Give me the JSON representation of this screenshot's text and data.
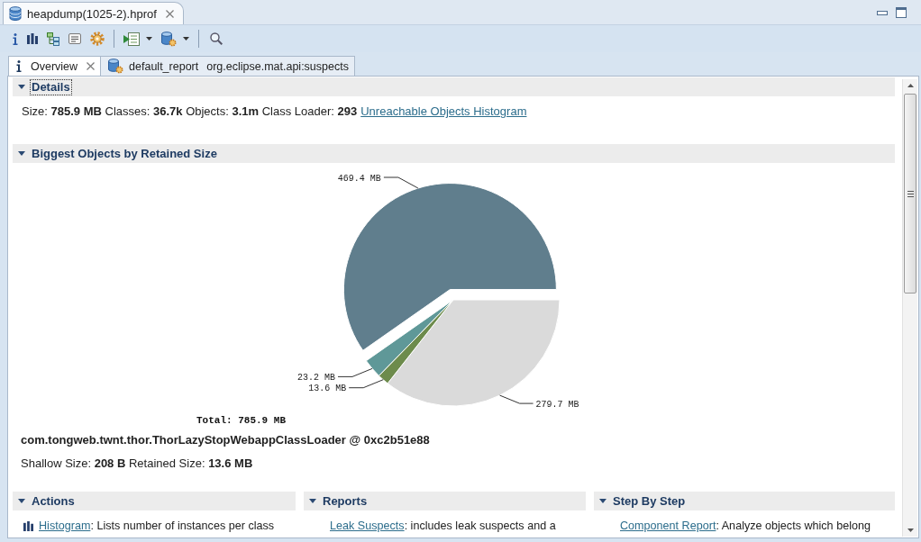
{
  "editor_tabs": [
    {
      "label": "heapdump(1025-2).hprof",
      "selected": true,
      "closable": true
    }
  ],
  "view_tabs": [
    {
      "kind": "info",
      "label": "Overview",
      "selected": true,
      "closable": true
    },
    {
      "kind": "report",
      "label": "default_report",
      "detail": "org.eclipse.mat.api:suspects",
      "selected": false,
      "closable": false
    }
  ],
  "details": {
    "title": "Details",
    "expanded": true,
    "focused": true,
    "summary": "Size: **785.9 MB** Classes: **36.7k** Objects: **3.1m** Class Loader: **293**",
    "link": "Unreachable Objects Histogram"
  },
  "biggest_objects": {
    "title": "Biggest Objects by Retained Size",
    "expanded": true,
    "focused": false,
    "chart_data": {
      "type": "pie",
      "title": "Total: 785.9 MB",
      "values": [
        469.4,
        23.2,
        13.6,
        279.7
      ],
      "value_labels": [
        "469.4 MB",
        "23.2 MB",
        "13.6 MB",
        "279.7 MB"
      ],
      "colors": [
        "#607e8d",
        "#5f9898",
        "#6d8b4c",
        "#dadada"
      ]
    },
    "object_name": "com.tongweb.twnt.thor.ThorLazyStopWebappClassLoader @ 0xc2b51e88",
    "sizes": "Shallow Size: **208 B** Retained Size: **13.6 MB**"
  },
  "panels": [
    {
      "title": "Actions",
      "expanded": true,
      "focused": false,
      "entries": [
        {
          "kind": "histogram",
          "link": "Histogram",
          "description": ": Lists number of instances per class"
        }
      ]
    },
    {
      "title": "Reports",
      "expanded": true,
      "focused": false,
      "entries": [
        {
          "kind": "report",
          "link": "Leak Suspects",
          "description": ": includes leak suspects and a"
        }
      ]
    },
    {
      "title": "Step By Step",
      "expanded": true,
      "focused": false,
      "entries": [
        {
          "kind": "report",
          "link": "Component Report",
          "description": ": Analyze objects which belong"
        }
      ]
    }
  ]
}
